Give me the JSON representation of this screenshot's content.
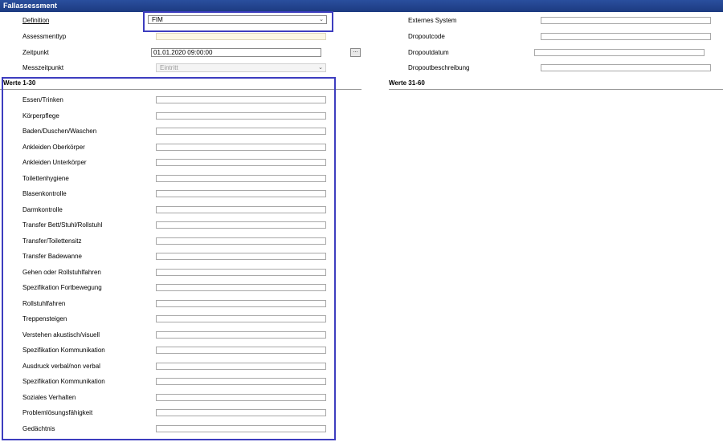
{
  "window": {
    "title": "Fallassessment"
  },
  "form": {
    "definition_label": "Definition",
    "definition_value": "FIM",
    "assessmenttyp_label": "Assessmenttyp",
    "zeitpunkt_label": "Zeitpunkt",
    "zeitpunkt_value": "01.01.2020 09:00:00",
    "dots_label": "...",
    "messzeitpunkt_label": "Messzeitpunkt",
    "messzeitpunkt_value": "Eintritt",
    "externes_system_label": "Externes System",
    "dropoutcode_label": "Dropoutcode",
    "dropoutdatum_label": "Dropoutdatum",
    "dropoutbeschreibung_label": "Dropoutbeschreibung"
  },
  "sections": {
    "werte_1_30": "Werte 1-30",
    "werte_31_60": "Werte 31-60"
  },
  "werte": [
    "Essen/Trinken",
    "Körperpflege",
    "Baden/Duschen/Waschen",
    "Ankleiden Oberkörper",
    "Ankleiden Unterkörper",
    "Toilettenhygiene",
    "Blasenkontrolle",
    "Darmkontrolle",
    "Transfer Bett/Stuhl/Rollstuhl",
    "Transfer/Toilettensitz",
    "Transfer Badewanne",
    "Gehen oder Rollstuhlfahren",
    "Spezifikation Fortbewegung",
    "Rollstuhlfahren",
    "Treppensteigen",
    "Verstehen akustisch/visuell",
    "Spezifikation Kommunikation",
    "Ausdruck verbal/non verbal",
    "Spezifikation Kommunikation",
    "Soziales Verhalten",
    "Problemlösungsfähigkeit",
    "Gedächtnis"
  ],
  "icons": {
    "dropdown": "chevron-down-icon"
  },
  "colors": {
    "titlebar": "#1c3a80",
    "highlight": "#3d3dbf",
    "readonly_field": "#fbf7e4"
  }
}
